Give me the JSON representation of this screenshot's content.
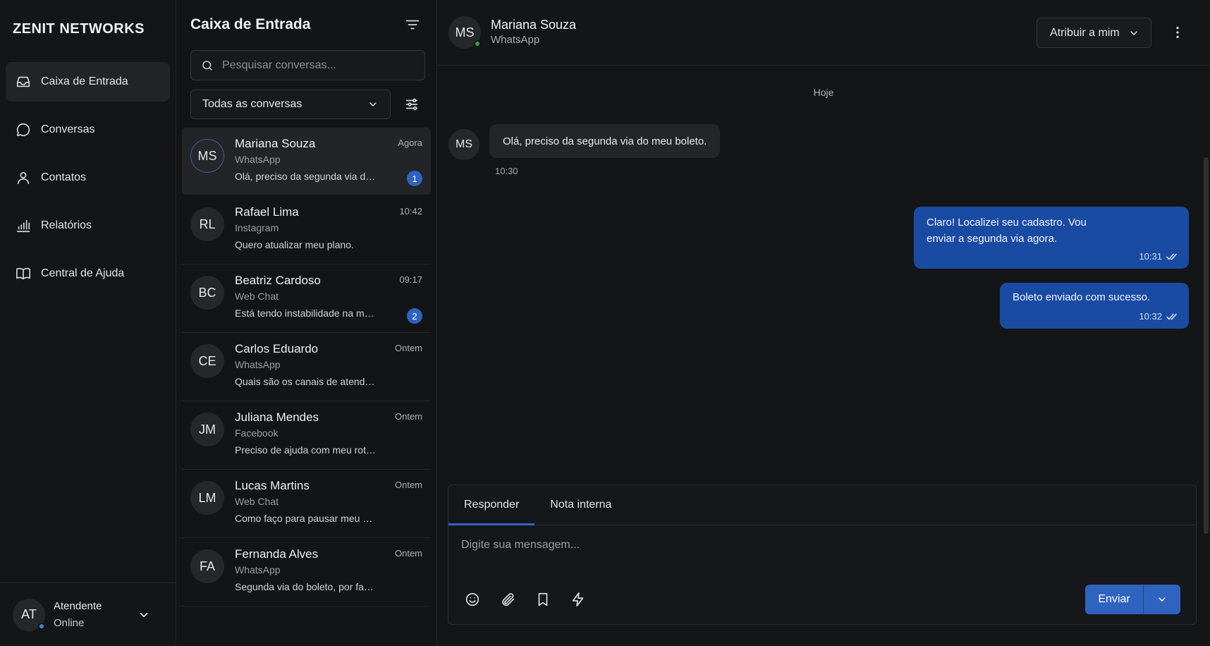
{
  "brand": "ZENIT NETWORKS",
  "nav": {
    "items": [
      {
        "label": "Caixa de Entrada",
        "icon": "inbox-icon",
        "active": true
      },
      {
        "label": "Conversas",
        "icon": "chat-bubble-icon"
      },
      {
        "label": "Contatos",
        "icon": "user-icon"
      },
      {
        "label": "Relatórios",
        "icon": "bar-chart-icon"
      },
      {
        "label": "Central de Ajuda",
        "icon": "book-icon"
      }
    ]
  },
  "user": {
    "initials": "AT",
    "name": "Atendente",
    "status": "Online",
    "presence_color": "#3f7fd6"
  },
  "inbox": {
    "title": "Caixa de Entrada",
    "search_placeholder": "Pesquisar conversas...",
    "filter_selected": "Todas as conversas"
  },
  "conversations": [
    {
      "initials": "MS",
      "name": "Mariana Souza",
      "channel": "WhatsApp",
      "preview": "Olá, preciso da segunda via do meu boleto.",
      "time": "Agora",
      "unread": "1"
    },
    {
      "initials": "RL",
      "name": "Rafael Lima",
      "channel": "Instagram",
      "preview": "Quero atualizar meu plano.",
      "time": "10:42",
      "unread": ""
    },
    {
      "initials": "BC",
      "name": "Beatriz Cardoso",
      "channel": "Web Chat",
      "preview": "Está tendo instabilidade na minha conexão.",
      "time": "09:17",
      "unread": "2"
    },
    {
      "initials": "CE",
      "name": "Carlos Eduardo",
      "channel": "WhatsApp",
      "preview": "Quais são os canais de atendimento?",
      "time": "Ontem",
      "unread": ""
    },
    {
      "initials": "JM",
      "name": "Juliana Mendes",
      "channel": "Facebook",
      "preview": "Preciso de ajuda com meu roteador.",
      "time": "Ontem",
      "unread": ""
    },
    {
      "initials": "LM",
      "name": "Lucas Martins",
      "channel": "Web Chat",
      "preview": "Como faço para pausar meu plano?",
      "time": "Ontem",
      "unread": ""
    },
    {
      "initials": "FA",
      "name": "Fernanda Alves",
      "channel": "WhatsApp",
      "preview": "Segunda via do boleto, por favor.",
      "time": "Ontem",
      "unread": ""
    }
  ],
  "chat": {
    "contact_initials": "MS",
    "contact_name": "Mariana Souza",
    "contact_channel": "WhatsApp",
    "presence_color": "#22a447",
    "assign_label": "Atribuir a mim",
    "day_separator": "Hoje",
    "incoming": {
      "text": "Olá, preciso da segunda via do meu boleto.",
      "time": "10:30"
    },
    "outgoing": [
      {
        "text": "Claro! Localizei seu cadastro. Vou enviar a segunda via agora.",
        "time": "10:31"
      },
      {
        "text": "Boleto enviado com sucesso.",
        "time": "10:32"
      }
    ]
  },
  "composer": {
    "tabs": [
      "Responder",
      "Nota interna"
    ],
    "placeholder": "Digite sua mensagem...",
    "send_label": "Enviar"
  },
  "colors": {
    "accent": "#2f63c0",
    "outgoing_bubble": "#1a4ba3"
  }
}
